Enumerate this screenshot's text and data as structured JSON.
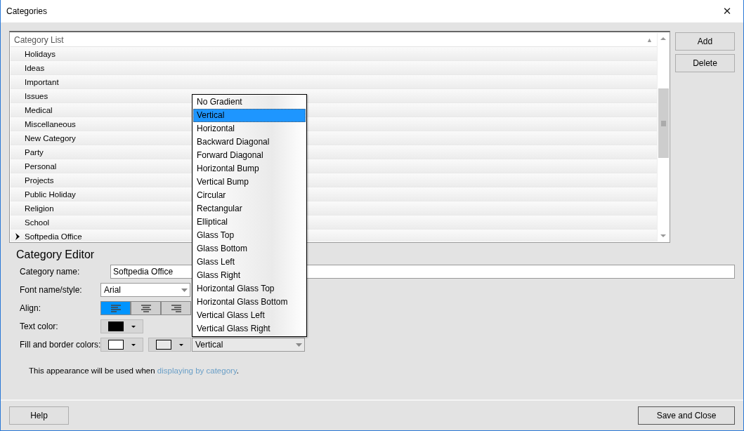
{
  "window": {
    "title": "Categories",
    "close": "✕"
  },
  "category_list": {
    "header": "Category List",
    "sort": "▲",
    "rows": [
      {
        "name": "Holidays",
        "selected": false
      },
      {
        "name": "Ideas",
        "selected": false
      },
      {
        "name": "Important",
        "selected": false
      },
      {
        "name": "Issues",
        "selected": false
      },
      {
        "name": "Medical",
        "selected": false
      },
      {
        "name": "Miscellaneous",
        "selected": false
      },
      {
        "name": "New Category",
        "selected": false
      },
      {
        "name": "Party",
        "selected": false
      },
      {
        "name": "Personal",
        "selected": false
      },
      {
        "name": "Projects",
        "selected": false
      },
      {
        "name": "Public Holiday",
        "selected": false
      },
      {
        "name": "Religion",
        "selected": false
      },
      {
        "name": "School",
        "selected": false
      },
      {
        "name": "Softpedia Office",
        "selected": true
      }
    ]
  },
  "side_buttons": [
    "Add",
    "Delete"
  ],
  "editor": {
    "title": "Category Editor",
    "name_label": "Category name:",
    "name_value": "Softpedia Office",
    "font_label": "Font name/style:",
    "font_value": "Arial",
    "align_label": "Align:",
    "align_options": [
      {
        "kind": "left",
        "selected": true
      },
      {
        "kind": "center",
        "selected": false
      },
      {
        "kind": "right",
        "selected": false
      }
    ],
    "text_color_label": "Text color:",
    "text_swatches": [
      {
        "color": "#000000"
      }
    ],
    "fill_label": "Fill and border colors:",
    "fill_swatches": [
      {
        "color": "#ffffff"
      },
      {
        "color": "#e8e8e8"
      }
    ],
    "gradient_value": "Vertical",
    "gradient_options": [
      {
        "label": "No Gradient",
        "selected": false
      },
      {
        "label": "Vertical",
        "selected": true
      },
      {
        "label": "Horizontal",
        "selected": false
      },
      {
        "label": "Backward Diagonal",
        "selected": false
      },
      {
        "label": "Forward Diagonal",
        "selected": false
      },
      {
        "label": "Horizontal Bump",
        "selected": false
      },
      {
        "label": "Vertical Bump",
        "selected": false
      },
      {
        "label": "Circular",
        "selected": false
      },
      {
        "label": "Rectangular",
        "selected": false
      },
      {
        "label": "Elliptical",
        "selected": false
      },
      {
        "label": "Glass Top",
        "selected": false
      },
      {
        "label": "Glass Bottom",
        "selected": false
      },
      {
        "label": "Glass Left",
        "selected": false
      },
      {
        "label": "Glass Right",
        "selected": false
      },
      {
        "label": "Horizontal Glass Top",
        "selected": false
      },
      {
        "label": "Horizontal Glass Bottom",
        "selected": false
      },
      {
        "label": "Vertical Glass Left",
        "selected": false
      },
      {
        "label": "Vertical Glass Right",
        "selected": false
      }
    ],
    "note": "This appearance will be used when",
    "note_link": "displaying by category",
    "note_end": "."
  },
  "footer": {
    "help": "Help",
    "save": "Save and Close"
  }
}
